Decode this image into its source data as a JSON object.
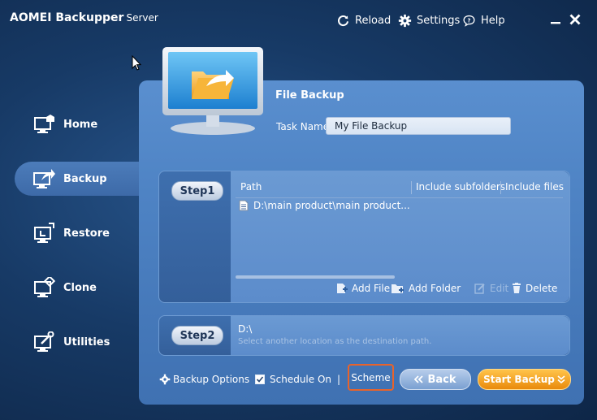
{
  "app": {
    "title": "AOMEI Backupper",
    "edition": "Server"
  },
  "titlebar": {
    "reload": "Reload",
    "settings": "Settings",
    "help": "Help"
  },
  "sidebar": {
    "items": [
      {
        "label": "Home"
      },
      {
        "label": "Backup",
        "active": true
      },
      {
        "label": "Restore"
      },
      {
        "label": "Clone"
      },
      {
        "label": "Utilities"
      }
    ]
  },
  "main": {
    "title": "File Backup",
    "task_name_label": "Task Name",
    "task_name_value": "My File Backup",
    "step1": {
      "label": "Step1",
      "columns": [
        "Path",
        "Include subfolders",
        "Include files"
      ],
      "rows": [
        {
          "path": "D:\\main product\\main product..."
        }
      ],
      "actions": {
        "add_file": "Add File",
        "add_folder": "Add Folder",
        "edit": "Edit",
        "delete": "Delete"
      }
    },
    "step2": {
      "label": "Step2",
      "destination": "D:\\",
      "hint": "Select another location as the destination path."
    }
  },
  "bottom": {
    "backup_options": "Backup Options",
    "schedule_on": "Schedule On",
    "schedule_checked": true,
    "separator": "|",
    "scheme": "Scheme",
    "back": "Back",
    "start_backup": "Start Backup"
  },
  "colors": {
    "accent_orange": "#e98a0c",
    "highlight_border": "#e8632b",
    "panel_blue": "#4e83c4"
  }
}
